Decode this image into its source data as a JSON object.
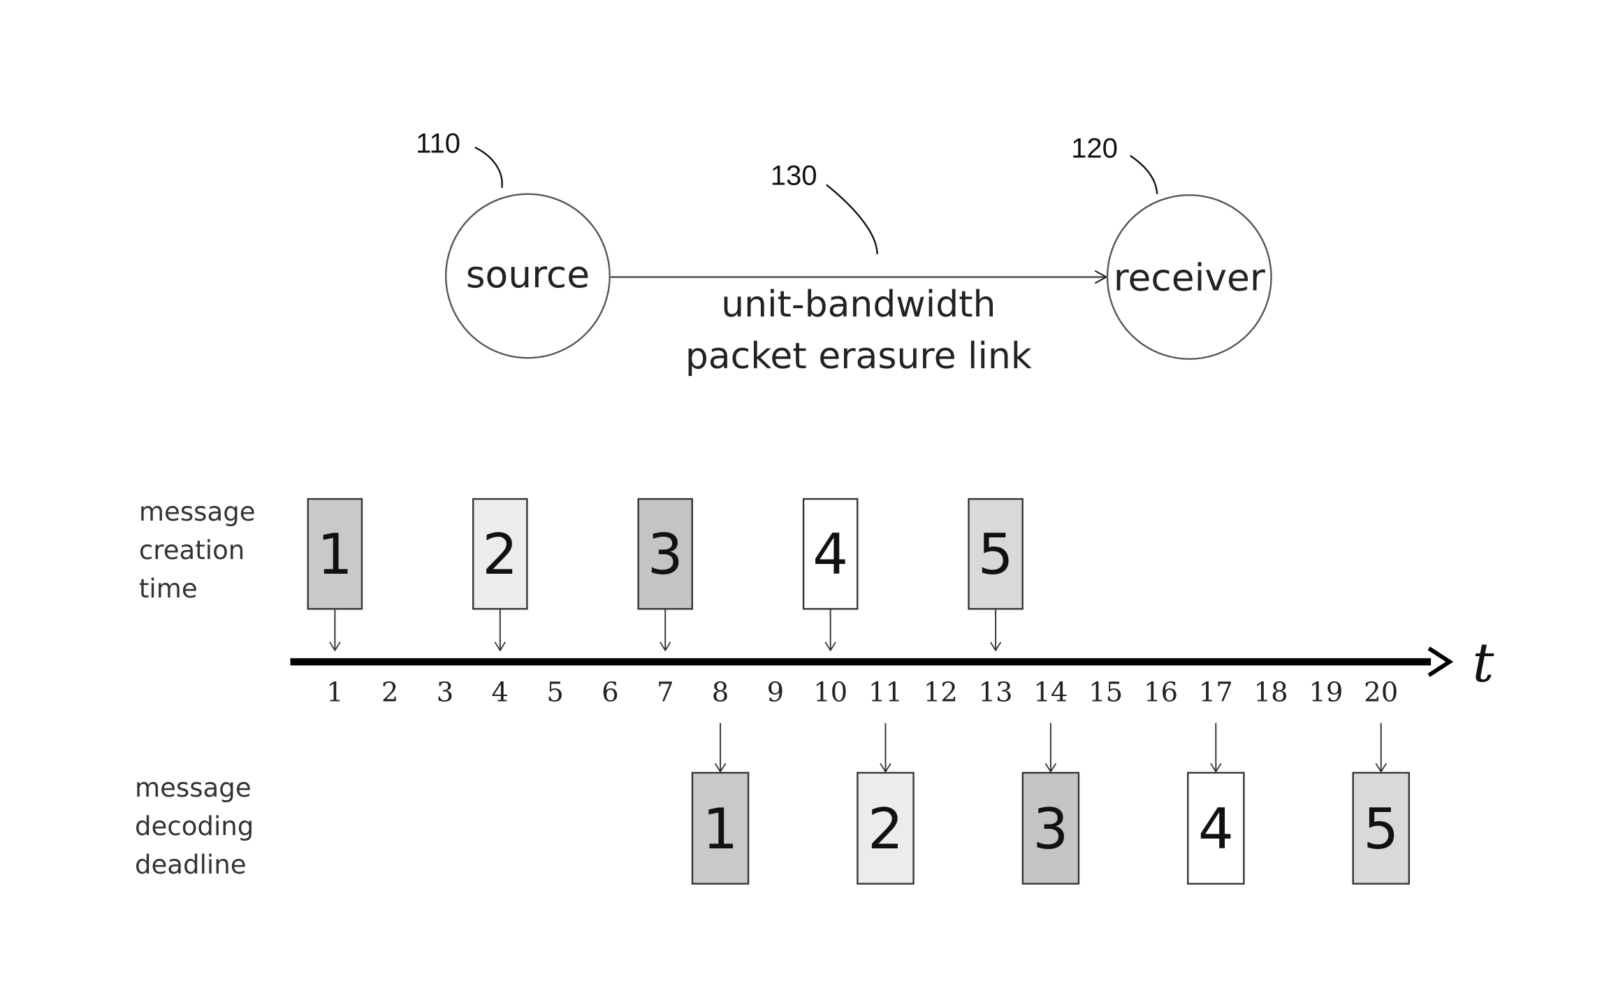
{
  "network": {
    "source": {
      "label": "source",
      "ref": "110"
    },
    "receiver": {
      "label": "receiver",
      "ref": "120"
    },
    "link": {
      "ref": "130",
      "label_line1": "unit-bandwidth",
      "label_line2": "packet erasure link"
    }
  },
  "timeline": {
    "axis_label": "t",
    "ticks": [
      "1",
      "2",
      "3",
      "4",
      "5",
      "6",
      "7",
      "8",
      "9",
      "10",
      "11",
      "12",
      "13",
      "14",
      "15",
      "16",
      "17",
      "18",
      "19",
      "20"
    ],
    "creation_row_label": [
      "message",
      "creation",
      "time"
    ],
    "deadline_row_label": [
      "message",
      "decoding",
      "deadline"
    ],
    "messages": [
      {
        "id": "1",
        "creation_time": 1,
        "deadline": 8,
        "fill": "#c9c9c9"
      },
      {
        "id": "2",
        "creation_time": 4,
        "deadline": 11,
        "fill": "#ececec"
      },
      {
        "id": "3",
        "creation_time": 7,
        "deadline": 14,
        "fill": "#c4c4c4"
      },
      {
        "id": "4",
        "creation_time": 10,
        "deadline": 17,
        "fill": "#ffffff"
      },
      {
        "id": "5",
        "creation_time": 13,
        "deadline": 20,
        "fill": "#d9d9d9"
      }
    ]
  }
}
